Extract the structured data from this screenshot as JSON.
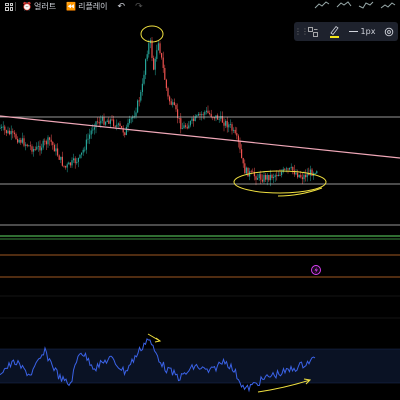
{
  "toolbar_top": {
    "alert_label": "얼러트",
    "replay_label": "리플레이"
  },
  "drawing_toolbar": {
    "line_width_label": "1px",
    "highlighter_color": "#f5e61a"
  },
  "colors": {
    "background": "#000000",
    "price_up": "#26a69a",
    "price_down": "#ef5350",
    "trendline": "#f0a8b8",
    "horizontal_line": "#c8c8c8",
    "green_line": "#4caf50",
    "orange_line": "#d6762e",
    "indicator_line": "#3b63e8",
    "annotation": "#f0e040",
    "alert_marker": "#e040fb"
  },
  "icons": [
    "grid-icon",
    "alarm-clock-icon",
    "replay-icon",
    "undo-icon",
    "redo-icon",
    "layout-icon",
    "highlighter-icon",
    "line-icon",
    "settings-icon"
  ]
}
